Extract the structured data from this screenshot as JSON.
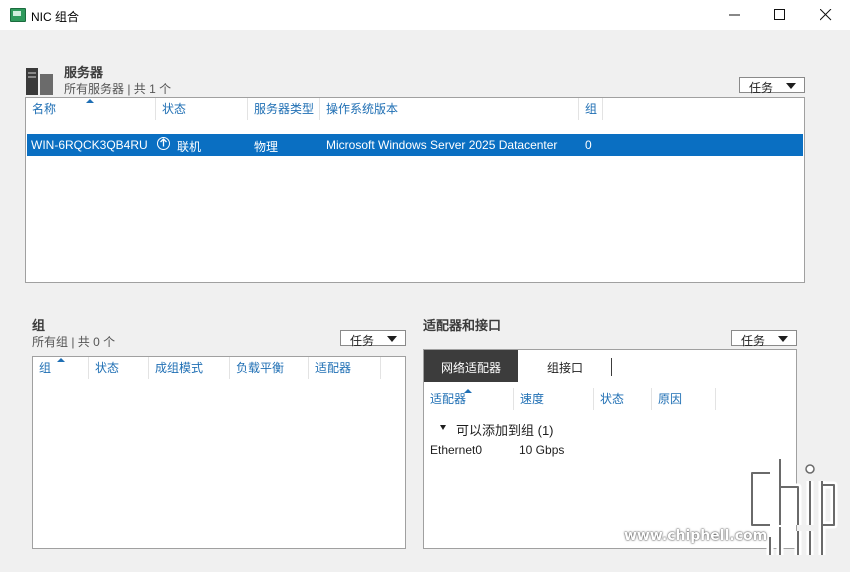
{
  "window": {
    "title": "NIC 组合"
  },
  "servers": {
    "title": "服务器",
    "subtitle": "所有服务器 | 共 1 个",
    "tasks_label": "任务",
    "columns": [
      "名称",
      "状态",
      "服务器类型",
      "操作系统版本",
      "组"
    ],
    "rows": [
      {
        "name": "WIN-6RQCK3QB4RU",
        "status": "联机",
        "type": "物理",
        "os": "Microsoft Windows Server 2025 Datacenter",
        "groups": "0"
      }
    ]
  },
  "teams": {
    "title": "组",
    "subtitle": "所有组 | 共 0 个",
    "tasks_label": "任务",
    "columns": [
      "组",
      "状态",
      "成组模式",
      "负载平衡",
      "适配器"
    ]
  },
  "adapters": {
    "title": "适配器和接口",
    "tasks_label": "任务",
    "tabs": [
      "网络适配器",
      "组接口"
    ],
    "columns": [
      "适配器",
      "速度",
      "状态",
      "原因"
    ],
    "group_label": "可以添加到组 (1)",
    "rows": [
      {
        "adapter": "Ethernet0",
        "speed": "10 Gbps"
      }
    ]
  },
  "watermark": {
    "text": "www.chiphell.com"
  },
  "colors": {
    "accent": "#0a6fc2",
    "header_text": "#1f6fb4",
    "tab_active": "#3c3c3c"
  }
}
